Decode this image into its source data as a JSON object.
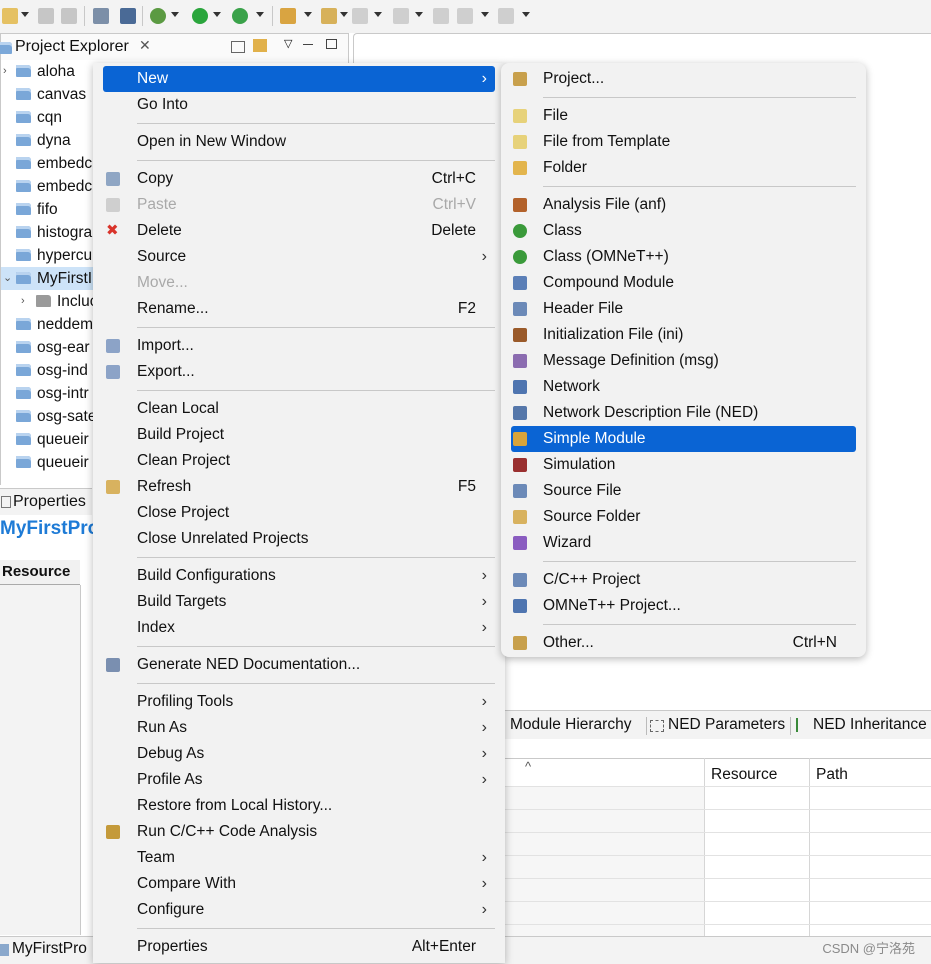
{
  "toolbar": {
    "icons": [
      "new-icon",
      "save-icon",
      "save-all-icon",
      "binary-icon",
      "edit-icon",
      "debug-icon",
      "run-icon",
      "external-tools-icon",
      "pencil-icon",
      "open-icon",
      "next-annotation-icon",
      "prev-annotation-icon",
      "last-edit-icon",
      "back-icon",
      "forward-icon"
    ]
  },
  "explorer": {
    "title": "Project Explorer",
    "close": "✕",
    "items": [
      {
        "label": "aloha"
      },
      {
        "label": "canvas"
      },
      {
        "label": "cqn"
      },
      {
        "label": "dyna"
      },
      {
        "label": "embedc"
      },
      {
        "label": "embedc"
      },
      {
        "label": "fifo"
      },
      {
        "label": "histogra"
      },
      {
        "label": "hypercu"
      },
      {
        "label": "MyFirstI"
      },
      {
        "label": "Incluc"
      },
      {
        "label": "neddem"
      },
      {
        "label": "osg-ear"
      },
      {
        "label": "osg-ind"
      },
      {
        "label": "osg-intr"
      },
      {
        "label": "osg-sate"
      },
      {
        "label": "queueir"
      },
      {
        "label": "queueir"
      }
    ]
  },
  "properties": {
    "title": "Properties",
    "heading": "MyFirstPro",
    "resource_tab": "Resource"
  },
  "bottom": {
    "tabs": [
      "Module Hierarchy",
      "NED Parameters",
      "NED Inheritance"
    ],
    "columns": [
      "Resource",
      "Path"
    ],
    "sort_mark": "^"
  },
  "status": {
    "text": "MyFirstPro"
  },
  "watermark": "CSDN @宁洛苑",
  "context_menu": {
    "items": [
      {
        "label": "New",
        "submenu": true,
        "highlighted": true
      },
      {
        "label": "Go Into"
      },
      {
        "label": "Open in New Window"
      },
      {
        "label": "Copy",
        "shortcut": "Ctrl+C",
        "icon": "copy-icon"
      },
      {
        "label": "Paste",
        "shortcut": "Ctrl+V",
        "disabled": true,
        "icon": "paste-icon"
      },
      {
        "label": "Delete",
        "shortcut": "Delete",
        "icon": "delete-icon"
      },
      {
        "label": "Source",
        "submenu": true
      },
      {
        "label": "Move...",
        "disabled": true
      },
      {
        "label": "Rename...",
        "shortcut": "F2"
      },
      {
        "label": "Import...",
        "icon": "import-icon"
      },
      {
        "label": "Export...",
        "icon": "export-icon"
      },
      {
        "label": "Clean Local"
      },
      {
        "label": "Build Project"
      },
      {
        "label": "Clean Project"
      },
      {
        "label": "Refresh",
        "shortcut": "F5",
        "icon": "refresh-icon"
      },
      {
        "label": "Close Project"
      },
      {
        "label": "Close Unrelated Projects"
      },
      {
        "label": "Build Configurations",
        "submenu": true
      },
      {
        "label": "Build Targets",
        "submenu": true
      },
      {
        "label": "Index",
        "submenu": true
      },
      {
        "label": "Generate NED Documentation...",
        "icon": "ned-doc-icon"
      },
      {
        "label": "Profiling Tools",
        "submenu": true
      },
      {
        "label": "Run As",
        "submenu": true
      },
      {
        "label": "Debug As",
        "submenu": true
      },
      {
        "label": "Profile As",
        "submenu": true
      },
      {
        "label": "Restore from Local History..."
      },
      {
        "label": "Run C/C++ Code Analysis",
        "icon": "code-analysis-icon"
      },
      {
        "label": "Team",
        "submenu": true
      },
      {
        "label": "Compare With",
        "submenu": true
      },
      {
        "label": "Configure",
        "submenu": true
      },
      {
        "label": "Properties",
        "shortcut": "Alt+Enter"
      }
    ]
  },
  "new_menu": {
    "items": [
      {
        "label": "Project...",
        "icon": "project-icon"
      },
      {
        "label": "File",
        "icon": "file-icon"
      },
      {
        "label": "File from Template",
        "icon": "file-template-icon"
      },
      {
        "label": "Folder",
        "icon": "folder-icon"
      },
      {
        "label": "Analysis File (anf)",
        "icon": "analysis-file-icon"
      },
      {
        "label": "Class",
        "icon": "class-icon"
      },
      {
        "label": "Class (OMNeT++)",
        "icon": "omnet-class-icon"
      },
      {
        "label": "Compound Module",
        "icon": "compound-module-icon"
      },
      {
        "label": "Header File",
        "icon": "header-file-icon"
      },
      {
        "label": "Initialization File (ini)",
        "icon": "ini-file-icon"
      },
      {
        "label": "Message Definition (msg)",
        "icon": "msg-file-icon"
      },
      {
        "label": "Network",
        "icon": "network-icon"
      },
      {
        "label": "Network Description File (NED)",
        "icon": "ned-file-icon"
      },
      {
        "label": "Simple Module",
        "icon": "simple-module-icon",
        "highlighted": true
      },
      {
        "label": "Simulation",
        "icon": "simulation-icon"
      },
      {
        "label": "Source File",
        "icon": "source-file-icon"
      },
      {
        "label": "Source Folder",
        "icon": "source-folder-icon"
      },
      {
        "label": "Wizard",
        "icon": "wizard-icon"
      },
      {
        "label": "C/C++ Project",
        "icon": "cpp-project-icon"
      },
      {
        "label": "OMNeT++ Project...",
        "icon": "omnet-project-icon"
      },
      {
        "label": "Other...",
        "shortcut": "Ctrl+N",
        "icon": "other-icon"
      }
    ]
  },
  "colors": {
    "highlight": "#0a64d4",
    "menu_bg": "#f2f2f2",
    "link_blue": "#1e7bd6"
  }
}
